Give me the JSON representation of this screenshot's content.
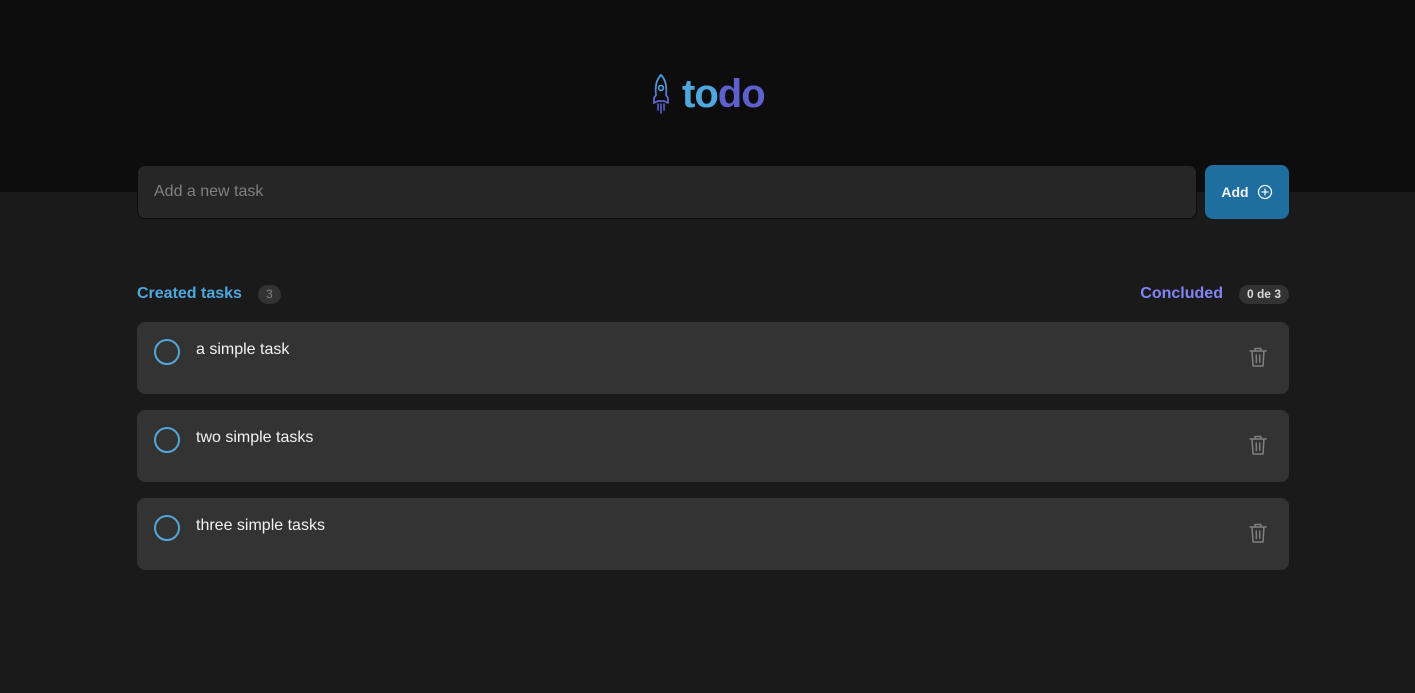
{
  "header": {
    "logo_icon": "rocket-icon",
    "logo_part1": "to",
    "logo_part2": "do",
    "colors": {
      "blue": "#4ea8de",
      "purple": "#5e60ce",
      "background": "#0d0d0d"
    }
  },
  "form": {
    "placeholder": "Add a new task",
    "value": "",
    "add_label": "Add",
    "add_icon": "plus-circle-icon",
    "button_color": "#1e6f9f"
  },
  "info": {
    "created_label": "Created tasks",
    "created_count": "3",
    "concluded_label": "Concluded",
    "concluded_count": "0 de 3"
  },
  "tasks": [
    {
      "text": "a simple task",
      "done": false
    },
    {
      "text": "two simple tasks",
      "done": false
    },
    {
      "text": "three simple tasks",
      "done": false
    }
  ]
}
